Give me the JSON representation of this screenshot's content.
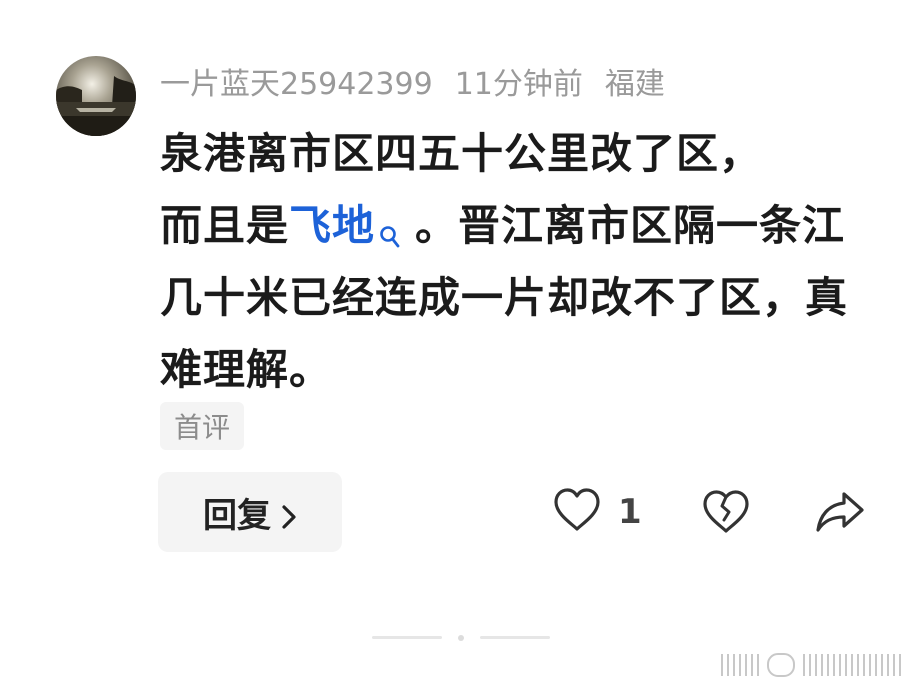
{
  "comment": {
    "username": "一片蓝天25942399",
    "time": "11分钟前",
    "location": "福建",
    "text_line1": "泉港离市区四五十公里改了区，",
    "text_before_link": "而且是",
    "link_word": "飞地",
    "text_after_link": "。晋江离市区隔一条江几十米已经连成一片却改不了区，真难理解。",
    "tag": "首评",
    "reply_label": "回复",
    "like_count": "1"
  },
  "icons": {
    "link": "search-icon",
    "reply": "chevron-right-icon",
    "like": "heart-outline-icon",
    "dislike": "broken-heart-icon",
    "share": "share-arrow-icon"
  },
  "colors": {
    "link": "#1d62d8",
    "meta": "#9a9a9a",
    "text": "#1b1b1b",
    "tag_bg": "#f4f4f4"
  }
}
